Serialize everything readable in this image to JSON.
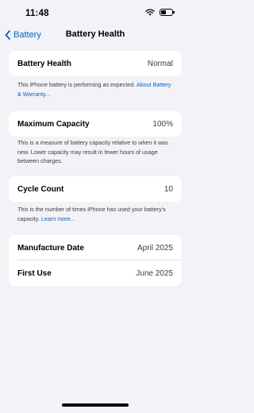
{
  "status_bar": {
    "time": "11:48"
  },
  "nav": {
    "back_label": "Battery",
    "title": "Battery Health"
  },
  "battery_health": {
    "label": "Battery Health",
    "value": "Normal",
    "note": "This iPhone battery is performing as expected.",
    "link": "About Battery & Warranty..."
  },
  "maximum_capacity": {
    "label": "Maximum Capacity",
    "value": "100%",
    "note": "This is a measure of battery capacity relative to when it was new. Lower capacity may result in fewer hours of usage between charges."
  },
  "cycle_count": {
    "label": "Cycle Count",
    "value": "10",
    "note": "This is the number of times iPhone has used your battery's capacity.",
    "link": "Learn more..."
  },
  "dates": [
    {
      "label": "Manufacture Date",
      "value": "April 2025"
    },
    {
      "label": "First Use",
      "value": "June 2025"
    }
  ],
  "colors": {
    "accent": "#0a63c9",
    "background": "#f2f2f7"
  }
}
